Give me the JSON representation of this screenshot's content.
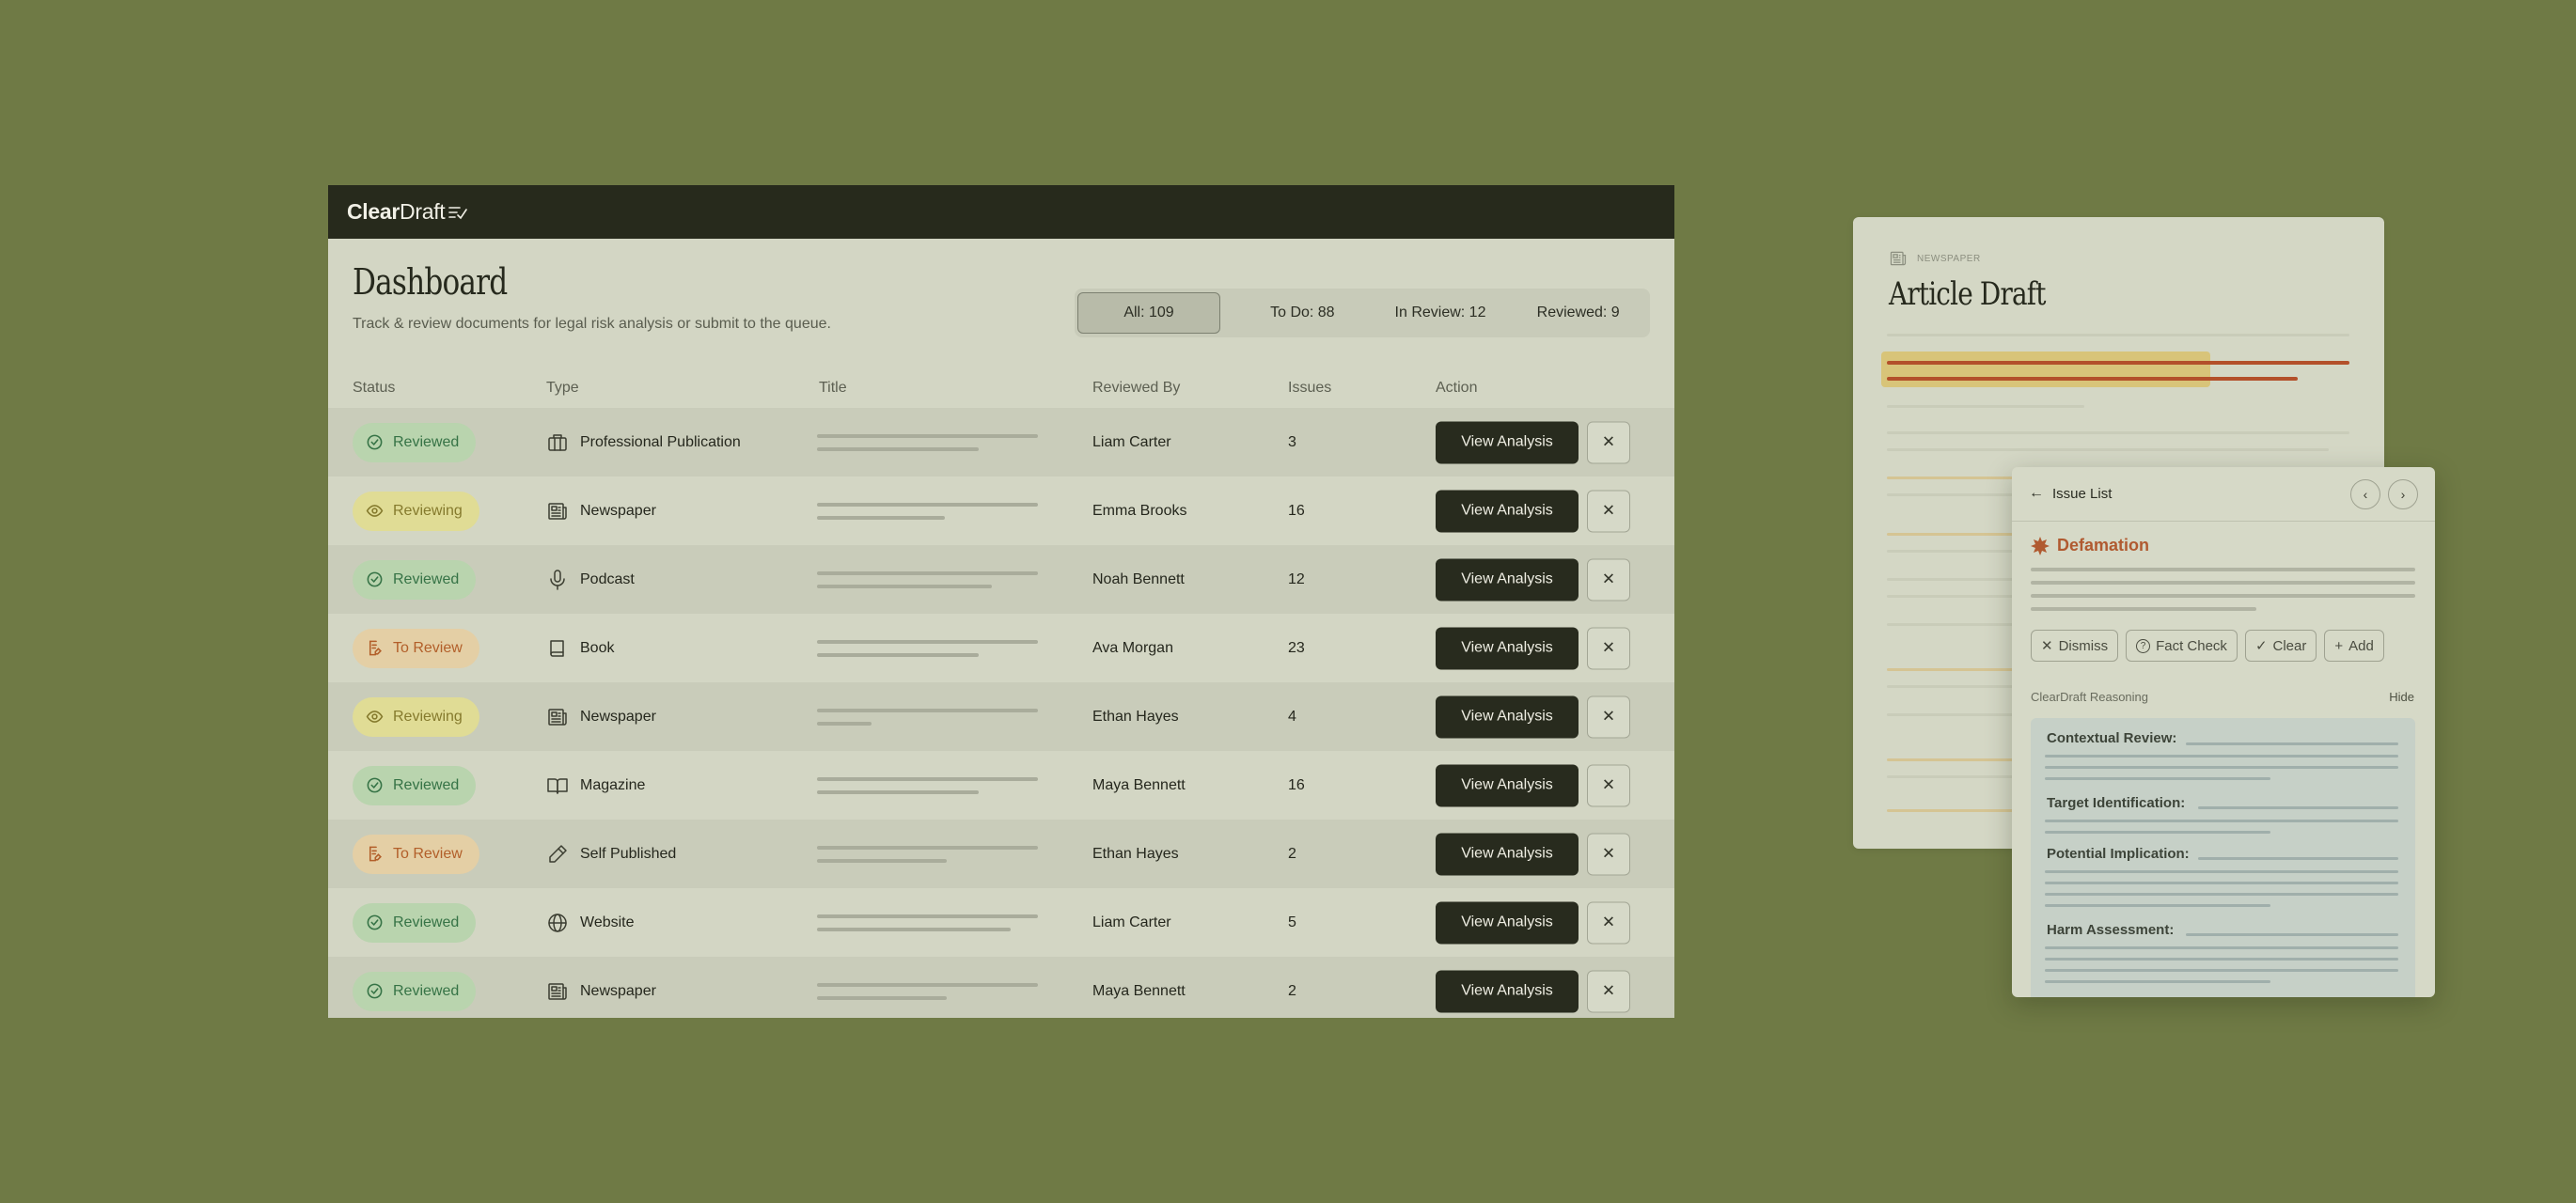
{
  "app": {
    "logo_bold": "Clear",
    "logo_light": "Draft"
  },
  "dashboard": {
    "title": "Dashboard",
    "subtitle": "Track & review documents for legal risk analysis or submit to the queue.",
    "filters": [
      "All: 109",
      "To Do: 88",
      "In Review: 12",
      "Reviewed: 9"
    ],
    "columns": {
      "status": "Status",
      "type": "Type",
      "title": "Title",
      "reviewed_by": "Reviewed By",
      "issues": "Issues",
      "action": "Action"
    },
    "view_label": "View Analysis",
    "close_glyph": "✕",
    "rows": [
      {
        "status": "Reviewed",
        "type": "Professional Publication",
        "reviewer": "Liam Carter",
        "issues": "3"
      },
      {
        "status": "Reviewing",
        "type": "Newspaper",
        "reviewer": "Emma Brooks",
        "issues": "16"
      },
      {
        "status": "Reviewed",
        "type": "Podcast",
        "reviewer": "Noah Bennett",
        "issues": "12"
      },
      {
        "status": "To Review",
        "type": "Book",
        "reviewer": "Ava Morgan",
        "issues": "23"
      },
      {
        "status": "Reviewing",
        "type": "Newspaper",
        "reviewer": "Ethan Hayes",
        "issues": "4"
      },
      {
        "status": "Reviewed",
        "type": "Magazine",
        "reviewer": "Maya Bennett",
        "issues": "16"
      },
      {
        "status": "To Review",
        "type": "Self Published",
        "reviewer": "Ethan Hayes",
        "issues": "2"
      },
      {
        "status": "Reviewed",
        "type": "Website",
        "reviewer": "Liam Carter",
        "issues": "5"
      },
      {
        "status": "Reviewed",
        "type": "Newspaper",
        "reviewer": "Maya Bennett",
        "issues": "2"
      }
    ]
  },
  "article": {
    "kicker": "NEWSPAPER",
    "title": "Article Draft"
  },
  "issue_panel": {
    "title": "Issue List",
    "issue_name": "Defamation",
    "actions": [
      "Dismiss",
      "Fact Check",
      "Clear",
      "Add"
    ],
    "reasoning_label": "ClearDraft Reasoning",
    "hide_label": "Hide",
    "sections": [
      "Contextual Review:",
      "Target Identification:",
      "Potential Implication:",
      "Harm Assessment:"
    ]
  },
  "colors": {
    "background": "#6f7a45",
    "topbar": "#272a1c",
    "reviewed": "#367346",
    "reviewing": "#857a2d",
    "to_review": "#b25f2a",
    "issue_accent": "#b05a30"
  }
}
